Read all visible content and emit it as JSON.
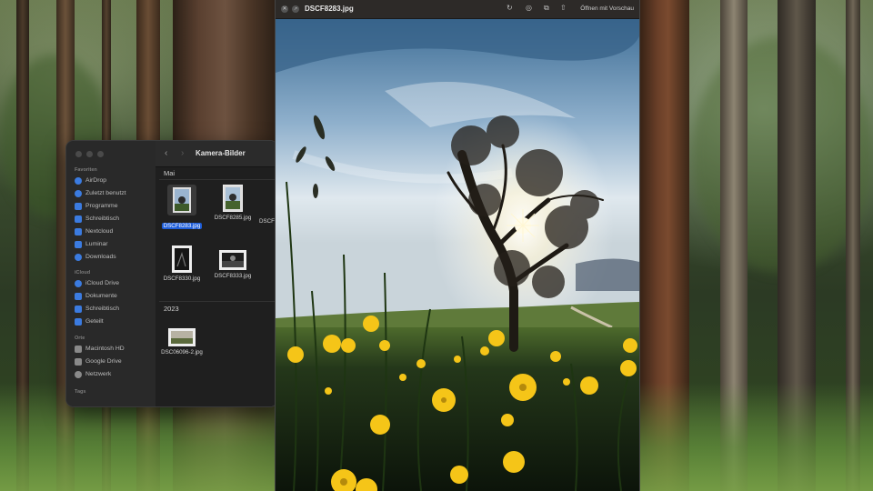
{
  "finder": {
    "title": "Kamera-Bilder",
    "sidebar": {
      "favorites_header": "Favoriten",
      "favorites": [
        "AirDrop",
        "Zuletzt benutzt",
        "Programme",
        "Schreibtisch",
        "Nextcloud",
        "Luminar",
        "Downloads"
      ],
      "icloud_header": "iCloud",
      "icloud": [
        "iCloud Drive",
        "Dokumente",
        "Schreibtisch",
        "Geteilt"
      ],
      "places_header": "Orte",
      "places": [
        "Macintosh HD",
        "Google Drive",
        "Netzwerk"
      ],
      "tags_header": "Tags"
    },
    "groups": [
      {
        "label": "Mai",
        "files": [
          "DSCF8283.jpg",
          "DSCF8285.jpg",
          "DSCF8330.jpg",
          "DSCF8333.jpg",
          "DSCF"
        ]
      },
      {
        "label": "2023",
        "files": [
          "DSC06096-2.jpg"
        ]
      }
    ],
    "selected_file": "DSCF8283.jpg"
  },
  "viewer": {
    "title": "DSCF8283.jpg",
    "open_with": "Öffnen mit Vorschau",
    "icons": [
      "close-icon",
      "fullscreen-icon",
      "rotate-icon",
      "markup-icon",
      "copy-icon",
      "share-icon"
    ]
  },
  "colors": {
    "selection": "#1f5ed9",
    "flower_yellow": "#f5c518"
  }
}
